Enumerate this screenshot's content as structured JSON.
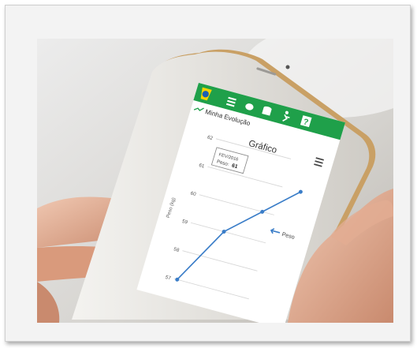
{
  "app": {
    "section_title": "Minha Evolução",
    "chart_title": "Gráfico",
    "tooltip_date": "FEV/2016",
    "tooltip_label": "Peso:",
    "tooltip_value": "61",
    "legend_label": "Peso",
    "axis_label": "Peso (kg)"
  },
  "colors": {
    "app_bar": "#1fa04a",
    "line": "#3a7dc8",
    "phone_body": "#e8e6e2",
    "gold_edge": "#d9b16a"
  },
  "icons": [
    "brazil-logo-icon",
    "menu-icon",
    "food-icon",
    "database-icon",
    "run-icon",
    "help-icon",
    "chart-menu-icon",
    "evolution-icon"
  ],
  "chart_data": {
    "type": "line",
    "title": "Gráfico",
    "ylabel": "Peso (kg)",
    "y_ticks": [
      57,
      58,
      59,
      60,
      61,
      62
    ],
    "ylim": [
      56.7,
      62
    ],
    "series": [
      {
        "name": "Peso",
        "values": [
          57,
          59,
          60,
          61
        ]
      }
    ]
  }
}
